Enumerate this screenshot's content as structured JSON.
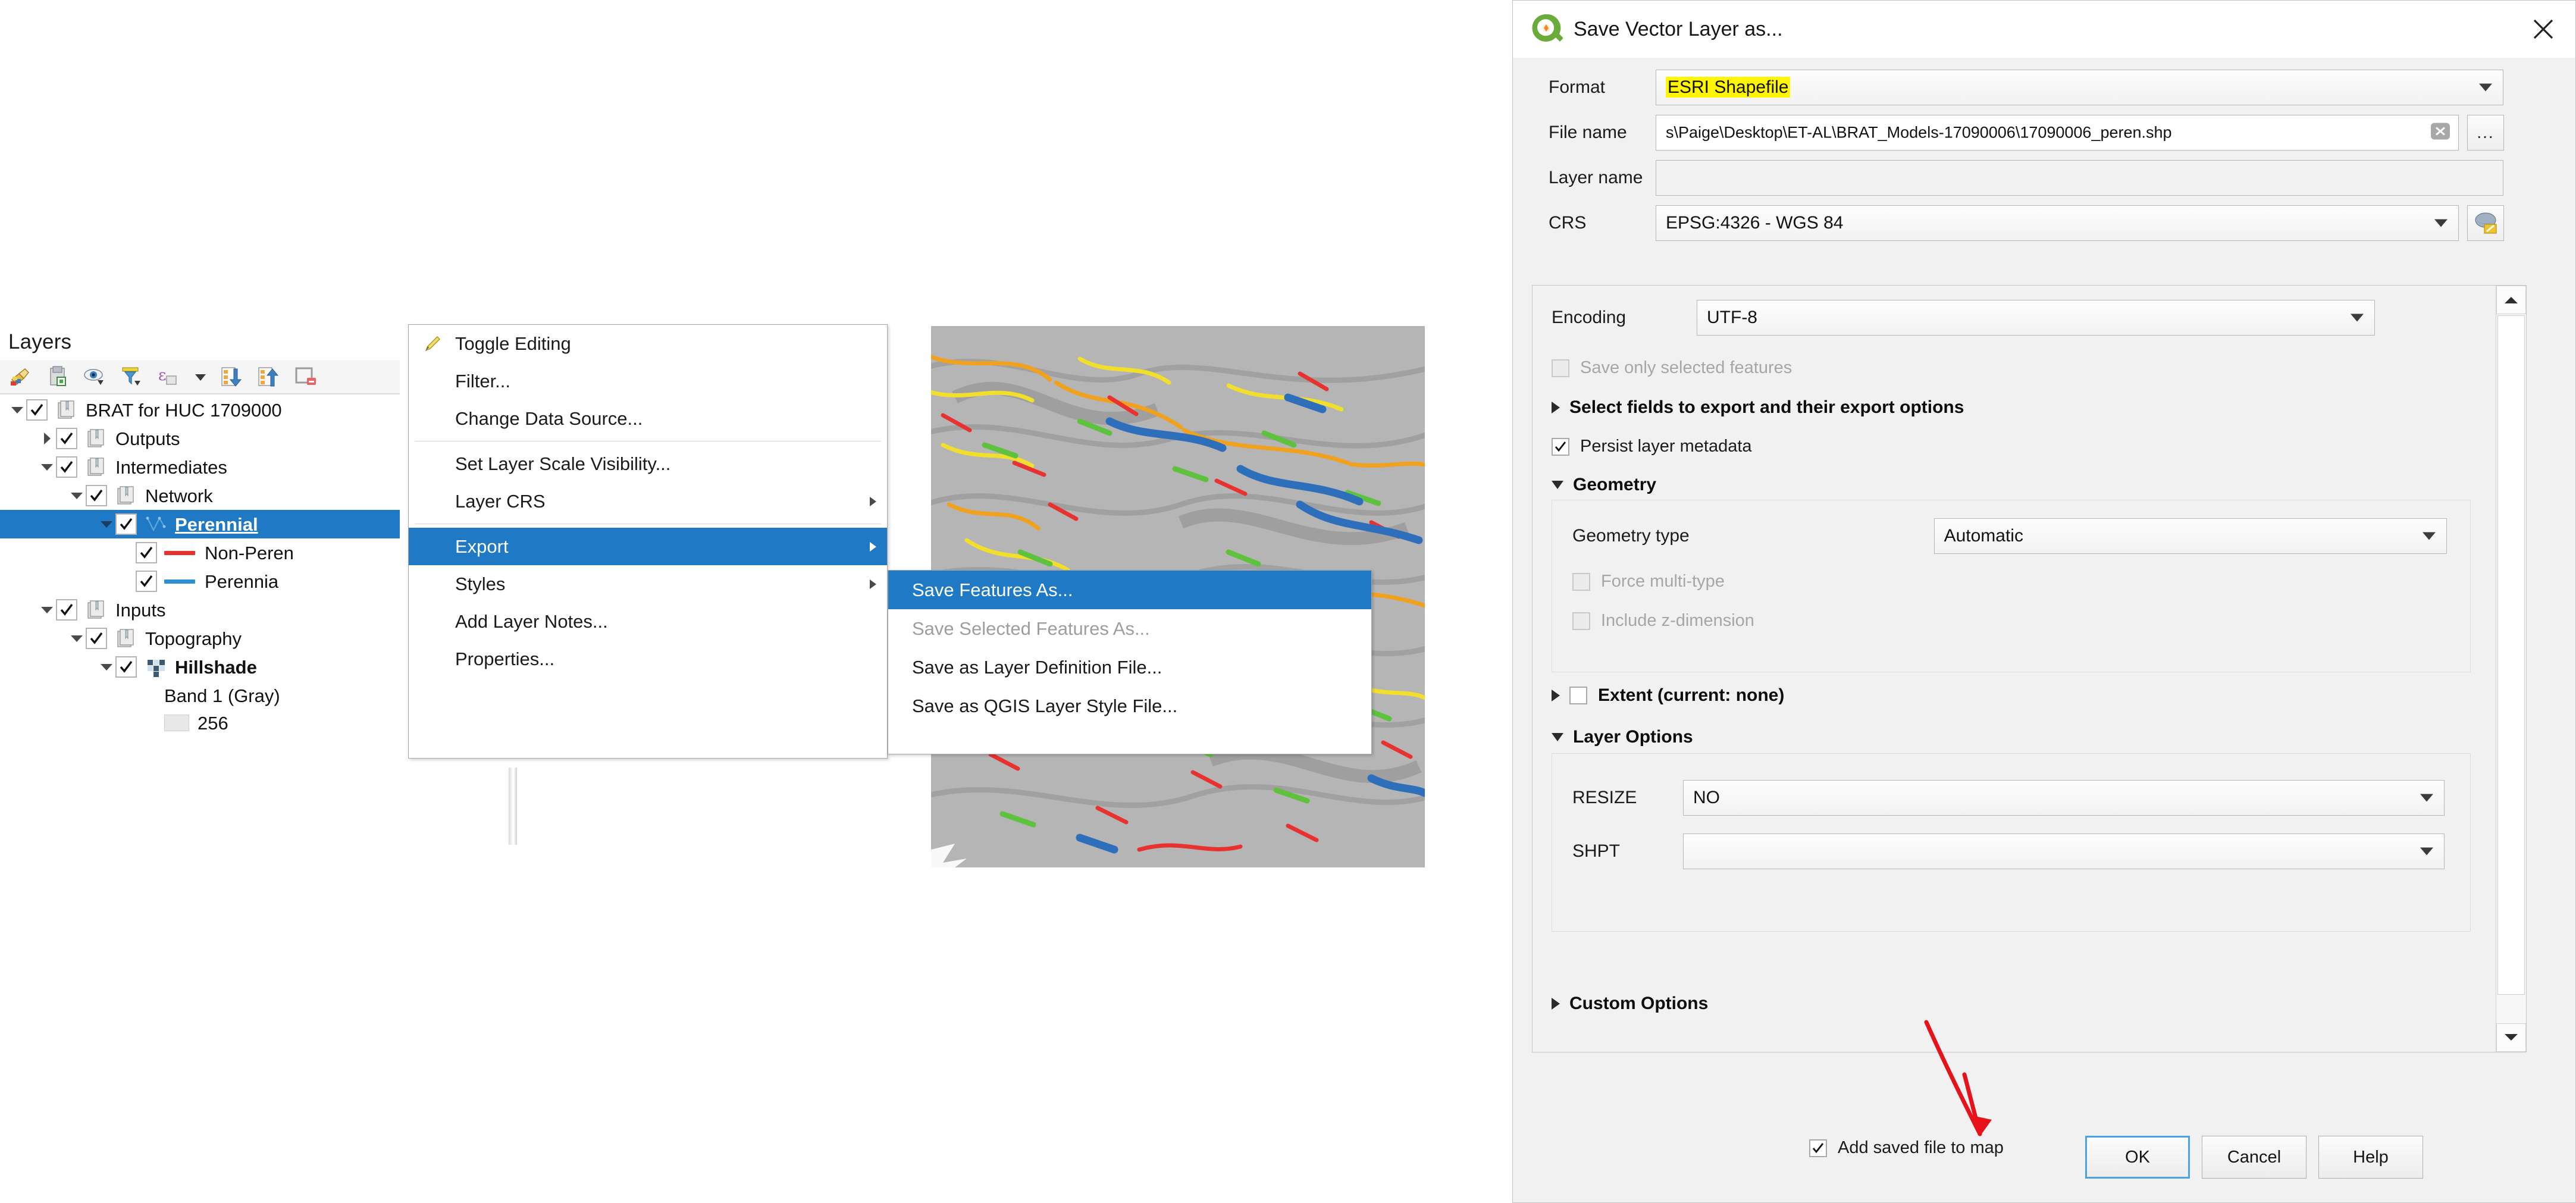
{
  "layers_panel": {
    "title": "Layers",
    "toolbar_icons": [
      "style-manager-icon",
      "add-group-icon",
      "manage-visibility-icon",
      "filter-legend-icon",
      "expression-filter-icon",
      "dropdown-arrow-icon",
      "expand-all-icon",
      "collapse-all-icon",
      "remove-layer-icon"
    ],
    "tree": [
      {
        "label": "BRAT for HUC 1709000",
        "indent": 0,
        "twisty": "down",
        "checked": true,
        "icon": "group-icon",
        "bold": false,
        "selected": false
      },
      {
        "label": "Outputs",
        "indent": 1,
        "twisty": "right",
        "checked": true,
        "icon": "group-icon",
        "bold": false,
        "selected": false
      },
      {
        "label": "Intermediates",
        "indent": 1,
        "twisty": "down",
        "checked": true,
        "icon": "group-icon",
        "bold": false,
        "selected": false
      },
      {
        "label": "Network",
        "indent": 2,
        "twisty": "down",
        "checked": true,
        "icon": "group-icon",
        "bold": false,
        "selected": false
      },
      {
        "label": "Perennial",
        "indent": 3,
        "twisty": "down",
        "checked": true,
        "icon": "vector-line-icon",
        "bold": true,
        "selected": true
      },
      {
        "label": "Non-Peren",
        "indent": 4,
        "twisty": "none",
        "checked": true,
        "icon": "line-swatch",
        "swatch_color": "#e8322f",
        "bold": false,
        "selected": false
      },
      {
        "label": "Perennia",
        "indent": 4,
        "twisty": "none",
        "checked": true,
        "icon": "line-swatch",
        "swatch_color": "#2d8fd1",
        "bold": false,
        "selected": false
      },
      {
        "label": "Inputs",
        "indent": 1,
        "twisty": "down",
        "checked": true,
        "icon": "group-icon",
        "bold": false,
        "selected": false
      },
      {
        "label": "Topography",
        "indent": 2,
        "twisty": "down",
        "checked": true,
        "icon": "group-icon",
        "bold": false,
        "selected": false
      },
      {
        "label": "Hillshade",
        "indent": 3,
        "twisty": "down",
        "checked": true,
        "icon": "raster-icon",
        "bold": true,
        "selected": false
      },
      {
        "label": "Band 1 (Gray)",
        "indent": 4,
        "twisty": "none",
        "checked": null,
        "icon": "none",
        "bold": false,
        "selected": false
      },
      {
        "label": "256",
        "indent": 4,
        "twisty": "none",
        "checked": null,
        "icon": "gray-swatch",
        "bold": false,
        "selected": false
      }
    ]
  },
  "context_menu": {
    "items": [
      {
        "label": "Toggle Editing",
        "icon": "pencil-icon",
        "submenu": false,
        "highlighted": false,
        "separator_after": false,
        "accel": "E"
      },
      {
        "label": "Filter...",
        "icon": "none",
        "submenu": false,
        "highlighted": false,
        "separator_after": false,
        "accel": "F"
      },
      {
        "label": "Change Data Source...",
        "icon": "none",
        "submenu": false,
        "highlighted": false,
        "separator_after": true,
        "accel": "h"
      },
      {
        "label": "Set Layer Scale Visibility...",
        "icon": "none",
        "submenu": false,
        "highlighted": false,
        "separator_after": false,
        "accel": "V"
      },
      {
        "label": "Layer CRS",
        "icon": "none",
        "submenu": true,
        "highlighted": false,
        "separator_after": true,
        "accel": ""
      },
      {
        "label": "Export",
        "icon": "none",
        "submenu": true,
        "highlighted": true,
        "separator_after": false,
        "accel": "x"
      },
      {
        "label": "Styles",
        "icon": "none",
        "submenu": true,
        "highlighted": false,
        "separator_after": false,
        "accel": "y"
      },
      {
        "label": "Add Layer Notes...",
        "icon": "none",
        "submenu": false,
        "highlighted": false,
        "separator_after": false,
        "accel": ""
      },
      {
        "label": "Properties...",
        "icon": "none",
        "submenu": false,
        "highlighted": false,
        "separator_after": false,
        "accel": "P"
      }
    ]
  },
  "export_submenu": {
    "items": [
      {
        "label": "Save Features As...",
        "highlighted": true,
        "disabled": false
      },
      {
        "label": "Save Selected Features As...",
        "highlighted": false,
        "disabled": true
      },
      {
        "label": "Save as Layer Definition File...",
        "highlighted": false,
        "disabled": false
      },
      {
        "label": "Save as QGIS Layer Style File...",
        "highlighted": false,
        "disabled": false
      }
    ]
  },
  "dialog": {
    "title": "Save Vector Layer as...",
    "app_icon": "qgis-logo-icon",
    "close_icon": "close-icon",
    "fields": {
      "format_label": "Format",
      "format_value": "ESRI Shapefile",
      "format_highlighted": true,
      "filename_label": "File name",
      "filename_value": "s\\Paige\\Desktop\\ET-AL\\BRAT_Models-17090006\\17090006_peren.shp",
      "filename_clear_icon": "clear-icon",
      "browse_label": "...",
      "layername_label": "Layer name",
      "layername_value": "",
      "crs_label": "CRS",
      "crs_value": "EPSG:4326 - WGS 84",
      "crs_select_icon": "crs-globe-icon"
    },
    "options": {
      "encoding_label": "Encoding",
      "encoding_value": "UTF-8",
      "save_only_selected_label": "Save only selected features",
      "save_only_selected_checked": false,
      "save_only_selected_disabled": true,
      "select_fields_label": "Select fields to export and their export options",
      "select_fields_expanded": false,
      "persist_metadata_label": "Persist layer metadata",
      "persist_metadata_checked": true,
      "geometry_section_label": "Geometry",
      "geometry_section_expanded": true,
      "geometry_type_label": "Geometry type",
      "geometry_type_value": "Automatic",
      "force_multi_label": "Force multi-type",
      "force_multi_checked": false,
      "force_multi_disabled": true,
      "include_z_label": "Include z-dimension",
      "include_z_checked": false,
      "include_z_disabled": true,
      "extent_label": "Extent (current: none)",
      "extent_checked": false,
      "extent_expanded": false,
      "layer_options_label": "Layer Options",
      "layer_options_expanded": true,
      "resize_label": "RESIZE",
      "resize_value": "NO",
      "shpt_label": "SHPT",
      "shpt_value": "",
      "custom_options_label": "Custom Options",
      "custom_options_expanded": false
    },
    "footer": {
      "add_saved_label": "Add saved file to map",
      "add_saved_checked": true,
      "ok_label": "OK",
      "cancel_label": "Cancel",
      "help_label": "Help"
    }
  },
  "annotation": {
    "arrow_color": "#e8131a",
    "points_to": "OK"
  },
  "colors": {
    "selection_blue": "#1f79c4",
    "highlight_yellow": "#fff600",
    "non_perennial": "#e8322f",
    "perennial": "#2d8fd1",
    "focus_blue": "#4aa3e8"
  }
}
